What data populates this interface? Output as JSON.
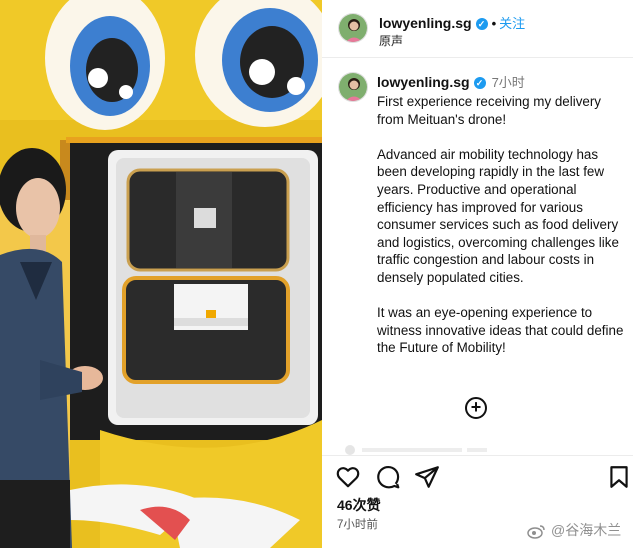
{
  "header": {
    "username": "lowyenling.sg",
    "separator": "•",
    "follow_label": "关注",
    "subtitle": "原声"
  },
  "post": {
    "username": "lowyenling.sg",
    "time": "7小时",
    "caption": [
      "First experience receiving my delivery from Meituan's drone!",
      "Advanced air mobility technology has been developing rapidly in the last few years. Productive and operational efficiency has improved for various consumer services such as food delivery and logistics, overcoming challenges like traffic congestion and labour costs in densely populated cities.",
      "It was an eye-opening experience to witness innovative ideas that could define the Future of Mobility!"
    ]
  },
  "actions": {
    "add_icon": "plus-circle-icon",
    "like_icon": "heart-icon",
    "comment_icon": "comment-icon",
    "share_icon": "send-icon",
    "save_icon": "bookmark-icon"
  },
  "stats": {
    "likes": "46次赞",
    "posted": "7小时前"
  },
  "watermark": {
    "text": "@谷海木兰"
  },
  "colors": {
    "verified": "#1d9bf0",
    "follow": "#1d9bf0",
    "photo_yellow": "#f2cf2a"
  }
}
